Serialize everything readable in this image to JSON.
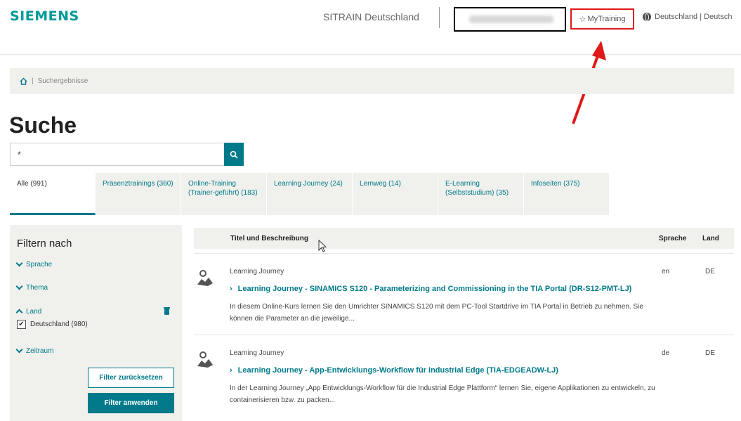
{
  "header": {
    "logo": "SIEMENS",
    "site_title": "SITRAIN Deutschland",
    "mytraining": "MyTraining",
    "language": "Deutschland | Deutsch"
  },
  "breadcrumb": {
    "current": "Suchergebnisse"
  },
  "page_title": "Suche",
  "search": {
    "value": "*"
  },
  "tabs": [
    {
      "label": "Alle (991)"
    },
    {
      "label": "Präsenztrainings (360)"
    },
    {
      "label": "Online-Training (Trainer-geführt) (183)"
    },
    {
      "label": "Learning Journey (24)"
    },
    {
      "label": "Lernweg (14)"
    },
    {
      "label": "E-Learning (Selbststudium) (35)"
    },
    {
      "label": "Infoseiten (375)"
    }
  ],
  "filters": {
    "heading": "Filtern nach",
    "sprache": "Sprache",
    "thema": "Thema",
    "land": "Land",
    "land_option": "Deutschland (980)",
    "zeitraum": "Zeitraum",
    "reset": "Filter zurücksetzen",
    "apply": "Filter anwenden"
  },
  "table": {
    "col_title": "Titel und Beschreibung",
    "col_lang": "Sprache",
    "col_land": "Land",
    "rows": [
      {
        "type": "Learning Journey",
        "title": "Learning Journey - SINAMICS S120 - Parameterizing and Commissioning in the TIA Portal (DR-S12-PMT-LJ)",
        "desc": "In diesem Online-Kurs lernen Sie den Umrichter SINAMICS S120 mit dem PC-Tool Startdrive im TIA Portal in Betrieb zu nehmen. Sie können die Parameter an die jeweilige...",
        "lang": "en",
        "land": "DE"
      },
      {
        "type": "Learning Journey",
        "title": "Learning Journey - App-Entwicklungs-Workflow für Industrial Edge (TIA-EDGEADW-LJ)",
        "desc": "In der Learning Journey „App Entwicklungs-Workflow für die Industrial Edge Plattform“ lernen Sie, eigene Applikationen zu entwickeln, zu containerisieren bzw. zu packen...",
        "lang": "de",
        "land": "DE"
      }
    ]
  },
  "colors": {
    "brand": "#009999",
    "accent": "#007a8a",
    "annotation": "#e01818"
  }
}
